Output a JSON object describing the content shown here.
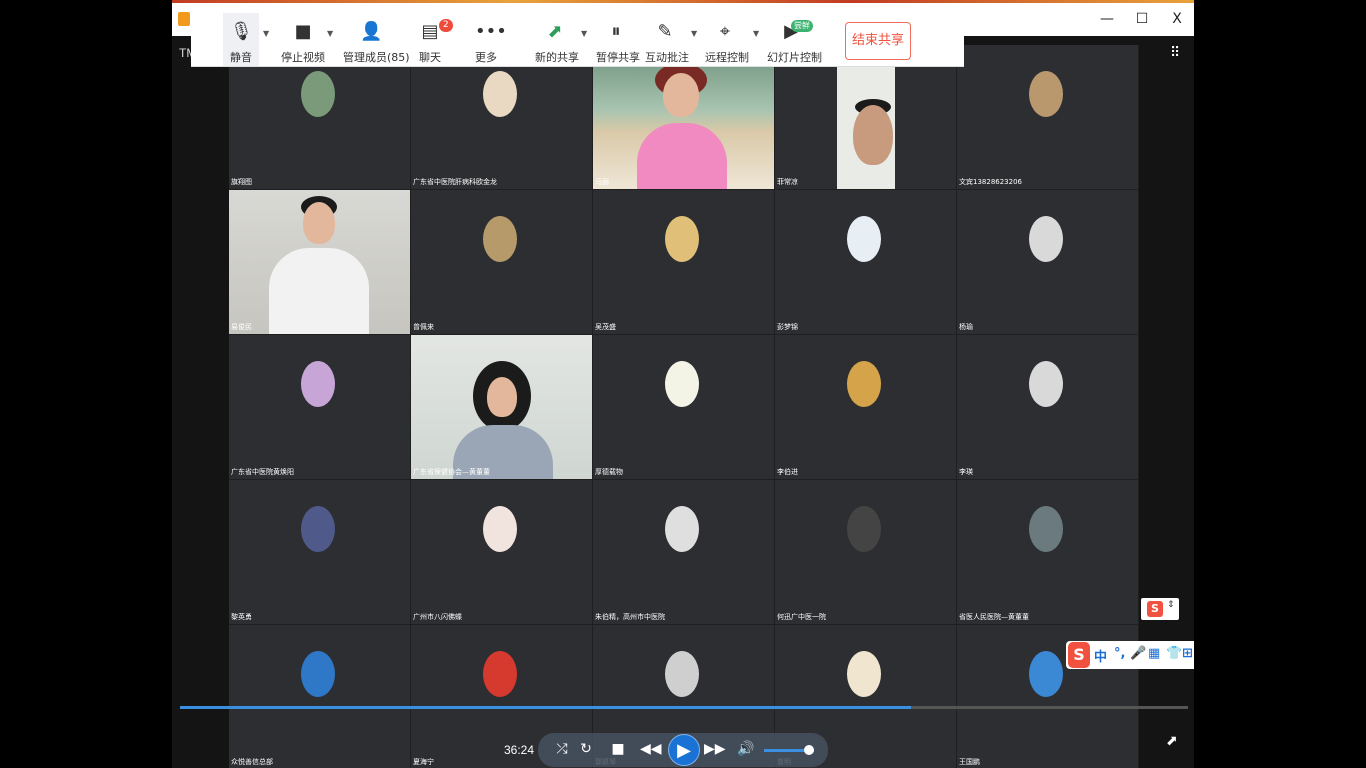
{
  "window": {
    "app_label": "TM",
    "minimize": "—",
    "maximize": "☐",
    "close": "X"
  },
  "toolbar": {
    "mute": "静音",
    "stop_video": "停止视频",
    "manage_members": "管理成员(85)",
    "chat": "聊天",
    "chat_badge": "2",
    "more": "更多",
    "new_share": "新的共享",
    "pause_share": "暂停共享",
    "annotate": "互动批注",
    "remote_control": "远程控制",
    "slideshow": "幻灯片控制",
    "slideshow_badge": "尝鲜",
    "end_share": "结束共享"
  },
  "participants": [
    {
      "name": "旗翔图"
    },
    {
      "name": "广东省中医院肝病科欧金龙"
    },
    {
      "name": "马丽"
    },
    {
      "name": "菲常凉"
    },
    {
      "name": "文宾13828623206"
    },
    {
      "name": "易俊民"
    },
    {
      "name": "曾佩来"
    },
    {
      "name": "吴茂盛"
    },
    {
      "name": "彭梦锦"
    },
    {
      "name": "杨瑜"
    },
    {
      "name": "广东省中医院黄焕阳"
    },
    {
      "name": "广东省保健协会—黄董董"
    },
    {
      "name": "厚德载物"
    },
    {
      "name": "李伯进"
    },
    {
      "name": "李瑛"
    },
    {
      "name": "黎英勇"
    },
    {
      "name": "广州市八闪佛蝶"
    },
    {
      "name": "朱伯精，高州市中医院"
    },
    {
      "name": "何迅广中医一院"
    },
    {
      "name": "省医人民医院—黄董董"
    },
    {
      "name": "众悦善信总部"
    },
    {
      "name": "夏海宁"
    },
    {
      "name": "郭凯琴"
    },
    {
      "name": "曾明"
    },
    {
      "name": "王国鹏"
    }
  ],
  "player": {
    "time": "36:24",
    "progress": 0.725,
    "volume": 0.9
  },
  "ime": {
    "lang": "中",
    "punct": "°,",
    "s": "S"
  }
}
